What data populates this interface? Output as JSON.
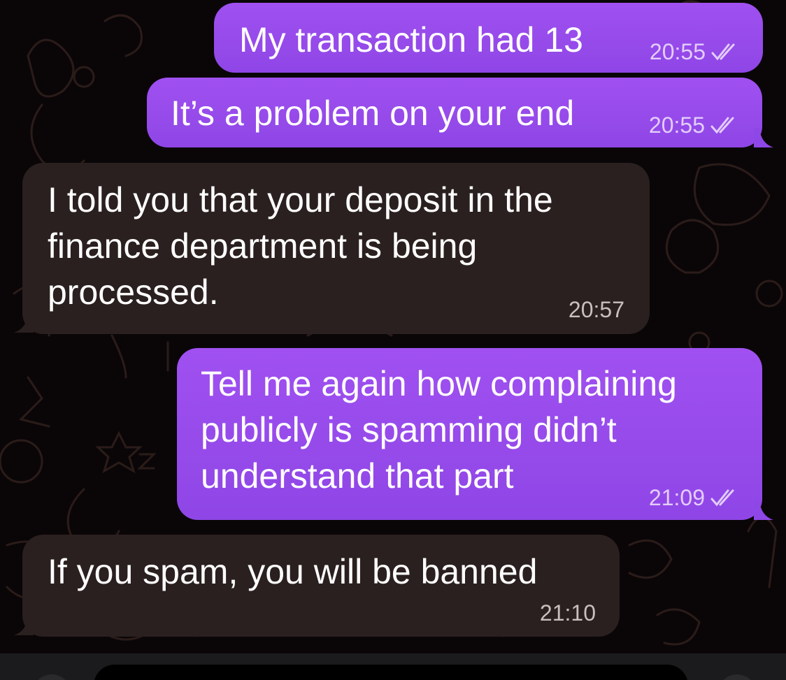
{
  "messages": [
    {
      "direction": "outgoing",
      "text": "My transaction had 13",
      "time": "20:55",
      "status": "read"
    },
    {
      "direction": "outgoing",
      "text": "It’s a problem on your end",
      "time": "20:55",
      "status": "read"
    },
    {
      "direction": "incoming",
      "text": "I told you that your deposit in the finance department is being processed.",
      "time": "20:57"
    },
    {
      "direction": "outgoing",
      "text": "Tell me again how complaining publicly is spamming didn’t understand that part",
      "time": "21:09",
      "status": "read"
    },
    {
      "direction": "incoming",
      "text": "If you spam, you will be banned",
      "time": "21:10"
    }
  ],
  "colors": {
    "outgoing_bubble": "#9a4cee",
    "incoming_bubble": "#2a201f",
    "background": "#0a0608"
  },
  "icons": [
    "double-check-icon",
    "attach-icon",
    "mic-icon"
  ]
}
